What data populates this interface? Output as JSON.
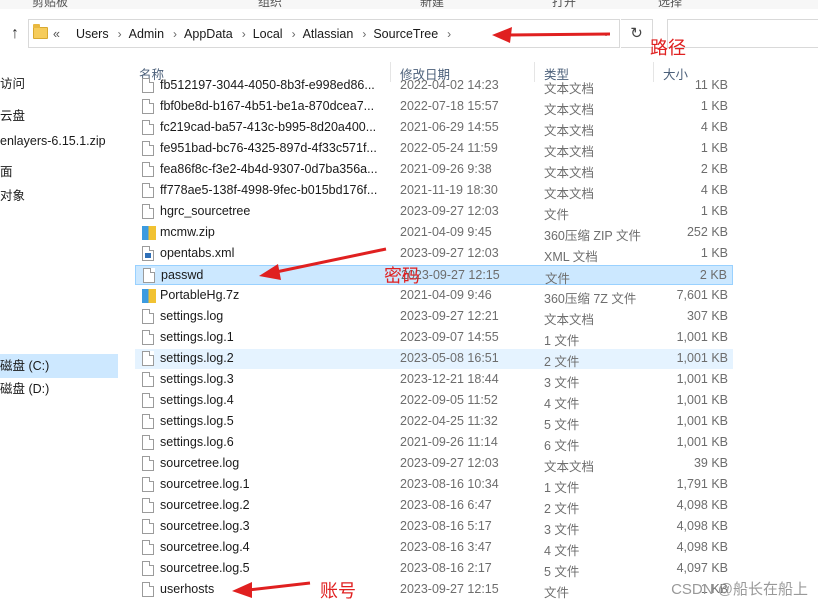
{
  "ribbon": {
    "labels": [
      "剪贴板",
      "组织",
      "新建",
      "打开",
      "选择"
    ]
  },
  "address_bar": {
    "segments": [
      "Users",
      "Admin",
      "AppData",
      "Local",
      "Atlassian",
      "SourceTree"
    ],
    "overflow": "«"
  },
  "columns": {
    "name": "名称",
    "date": "修改日期",
    "type": "类型",
    "size": "大小"
  },
  "nav": {
    "items": [
      {
        "label": "访问"
      },
      {
        "label": "云盘"
      },
      {
        "label": "enlayers-6.15.1.zip"
      },
      {
        "label": "面"
      },
      {
        "label": "对象"
      },
      {
        "label": "磁盘 (C:)",
        "selected": true
      },
      {
        "label": "磁盘 (D:)"
      }
    ]
  },
  "files": [
    {
      "name": "fb512197-3044-4050-8b3f-e998ed86...",
      "date": "2022-04-02 14:23",
      "type": "文本文档",
      "size": "11 KB",
      "icon": "file"
    },
    {
      "name": "fbf0be8d-b167-4b51-be1a-870dcea7...",
      "date": "2022-07-18 15:57",
      "type": "文本文档",
      "size": "1 KB",
      "icon": "file"
    },
    {
      "name": "fc219cad-ba57-413c-b995-8d20a400...",
      "date": "2021-06-29 14:55",
      "type": "文本文档",
      "size": "4 KB",
      "icon": "file"
    },
    {
      "name": "fe951bad-bc76-4325-897d-4f33c571f...",
      "date": "2022-05-24 11:59",
      "type": "文本文档",
      "size": "1 KB",
      "icon": "file"
    },
    {
      "name": "fea86f8c-f3e2-4b4d-9307-0d7ba356a...",
      "date": "2021-09-26 9:38",
      "type": "文本文档",
      "size": "2 KB",
      "icon": "file"
    },
    {
      "name": "ff778ae5-138f-4998-9fec-b015bd176f...",
      "date": "2021-11-19 18:30",
      "type": "文本文档",
      "size": "4 KB",
      "icon": "file"
    },
    {
      "name": "hgrc_sourcetree",
      "date": "2023-09-27 12:03",
      "type": "文件",
      "size": "1 KB",
      "icon": "file"
    },
    {
      "name": "mcmw.zip",
      "date": "2021-04-09 9:45",
      "type": "360压缩 ZIP 文件",
      "size": "252 KB",
      "icon": "zip"
    },
    {
      "name": "opentabs.xml",
      "date": "2023-09-27 12:03",
      "type": "XML 文档",
      "size": "1 KB",
      "icon": "xml"
    },
    {
      "name": "passwd",
      "date": "2023-09-27 12:15",
      "type": "文件",
      "size": "2 KB",
      "icon": "file",
      "selected": true
    },
    {
      "name": "PortableHg.7z",
      "date": "2021-04-09 9:46",
      "type": "360压缩 7Z 文件",
      "size": "7,601 KB",
      "icon": "zip"
    },
    {
      "name": "settings.log",
      "date": "2023-09-27 12:21",
      "type": "文本文档",
      "size": "307 KB",
      "icon": "file"
    },
    {
      "name": "settings.log.1",
      "date": "2023-09-07 14:55",
      "type": "1 文件",
      "size": "1,001 KB",
      "icon": "file"
    },
    {
      "name": "settings.log.2",
      "date": "2023-05-08 16:51",
      "type": "2 文件",
      "size": "1,001 KB",
      "icon": "file",
      "hover": true
    },
    {
      "name": "settings.log.3",
      "date": "2023-12-21 18:44",
      "type": "3 文件",
      "size": "1,001 KB",
      "icon": "file"
    },
    {
      "name": "settings.log.4",
      "date": "2022-09-05 11:52",
      "type": "4 文件",
      "size": "1,001 KB",
      "icon": "file"
    },
    {
      "name": "settings.log.5",
      "date": "2022-04-25 11:32",
      "type": "5 文件",
      "size": "1,001 KB",
      "icon": "file"
    },
    {
      "name": "settings.log.6",
      "date": "2021-09-26 11:14",
      "type": "6 文件",
      "size": "1,001 KB",
      "icon": "file"
    },
    {
      "name": "sourcetree.log",
      "date": "2023-09-27 12:03",
      "type": "文本文档",
      "size": "39 KB",
      "icon": "file"
    },
    {
      "name": "sourcetree.log.1",
      "date": "2023-08-16 10:34",
      "type": "1 文件",
      "size": "1,791 KB",
      "icon": "file"
    },
    {
      "name": "sourcetree.log.2",
      "date": "2023-08-16 6:47",
      "type": "2 文件",
      "size": "4,098 KB",
      "icon": "file"
    },
    {
      "name": "sourcetree.log.3",
      "date": "2023-08-16 5:17",
      "type": "3 文件",
      "size": "4,098 KB",
      "icon": "file"
    },
    {
      "name": "sourcetree.log.4",
      "date": "2023-08-16 3:47",
      "type": "4 文件",
      "size": "4,098 KB",
      "icon": "file"
    },
    {
      "name": "sourcetree.log.5",
      "date": "2023-08-16 2:17",
      "type": "5 文件",
      "size": "4,097 KB",
      "icon": "file"
    },
    {
      "name": "userhosts",
      "date": "2023-09-27 12:15",
      "type": "文件",
      "size": "1 KB",
      "icon": "file"
    }
  ],
  "annotations": {
    "path": "路径",
    "password": "密码",
    "account": "账号"
  },
  "watermark": "CSDN @船长在船上",
  "colors": {
    "annotation": "#e02020",
    "selection": "#cce8ff"
  }
}
